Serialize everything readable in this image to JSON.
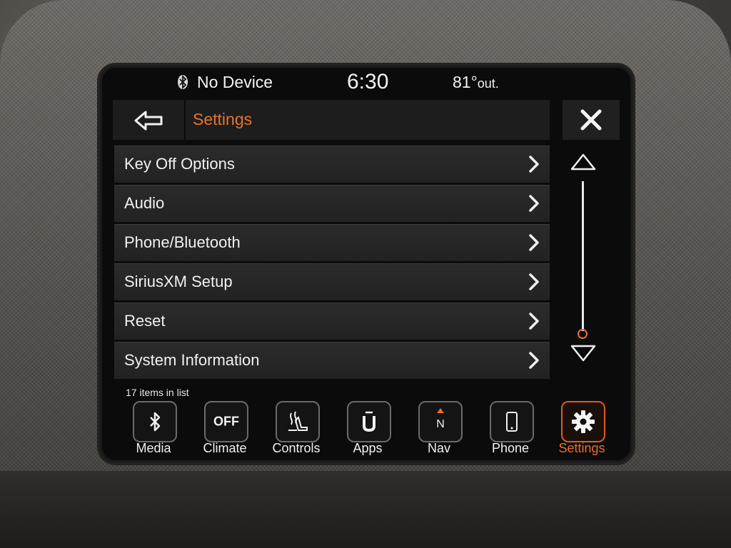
{
  "status_bar": {
    "device": "No Device",
    "time": "6:30",
    "temperature": "81°",
    "temperature_unit": "out."
  },
  "header": {
    "title": "Settings"
  },
  "menu": {
    "items": [
      {
        "label": "Key Off Options"
      },
      {
        "label": "Audio"
      },
      {
        "label": "Phone/Bluetooth"
      },
      {
        "label": "SiriusXM Setup"
      },
      {
        "label": "Reset"
      },
      {
        "label": "System Information"
      }
    ],
    "count_text": "17 items in list"
  },
  "dock": {
    "items": [
      {
        "label": "Media",
        "icon": "bluetooth-icon"
      },
      {
        "label": "Climate",
        "icon": "off-icon",
        "icon_text": "OFF"
      },
      {
        "label": "Controls",
        "icon": "seat-heat-icon"
      },
      {
        "label": "Apps",
        "icon": "apps-icon"
      },
      {
        "label": "Nav",
        "icon": "compass-icon",
        "icon_text": "N"
      },
      {
        "label": "Phone",
        "icon": "phone-icon"
      },
      {
        "label": "Settings",
        "icon": "gear-icon"
      }
    ],
    "active": "Settings"
  },
  "colors": {
    "accent": "#e8722c",
    "background": "#0b0b0c",
    "row": "#262627",
    "text": "#f1f1f1"
  }
}
